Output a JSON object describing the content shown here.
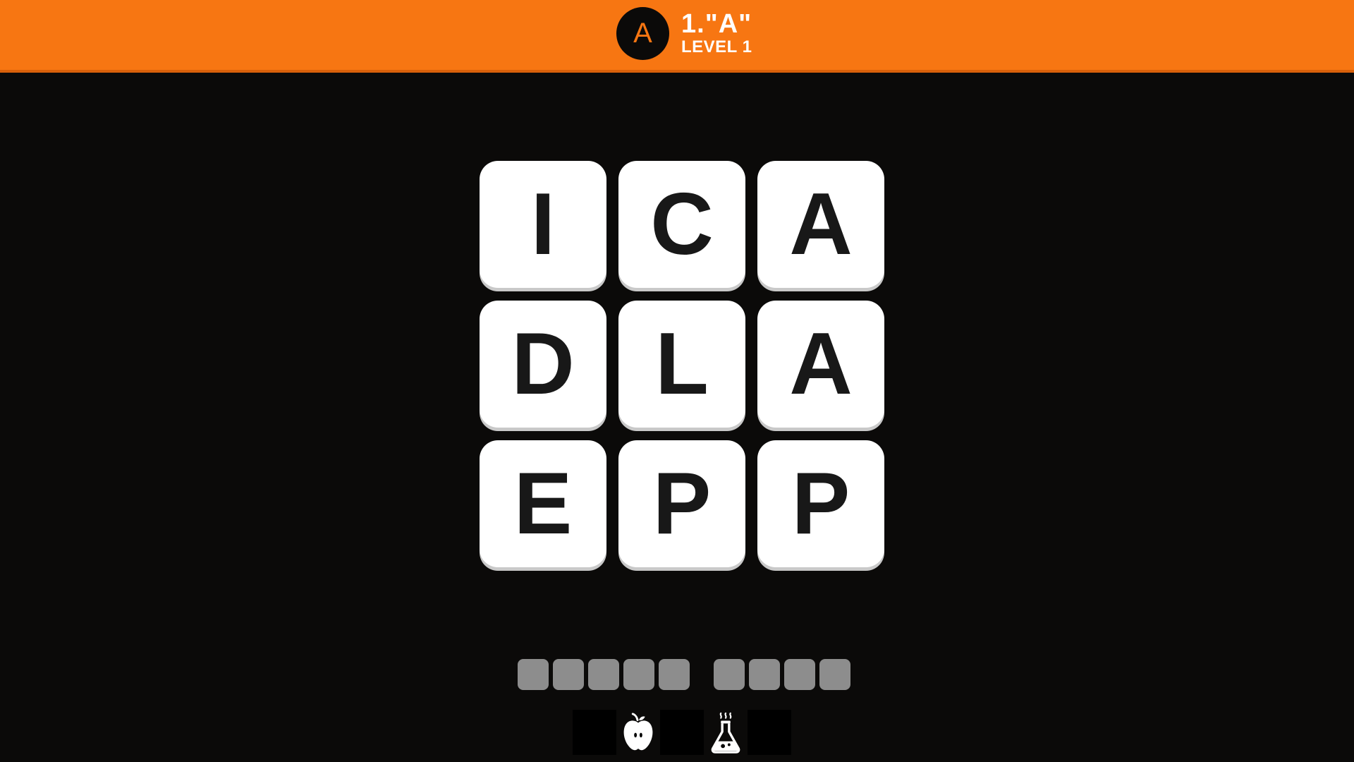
{
  "header": {
    "badge_letter": "A",
    "title": "1.\"A\"",
    "subtitle": "LEVEL 1"
  },
  "puzzle": {
    "tiles": [
      "I",
      "C",
      "A",
      "D",
      "L",
      "A",
      "E",
      "P",
      "P"
    ],
    "answer_word_lengths": [
      5,
      4
    ]
  },
  "toolbar": {
    "icons": [
      "apple-icon",
      "flask-icon"
    ]
  },
  "colors": {
    "accent": "#f77612",
    "background": "#0b0a09",
    "tile": "#ffffff",
    "tile_text": "#181818",
    "answer_slot": "#8d8d8d"
  }
}
